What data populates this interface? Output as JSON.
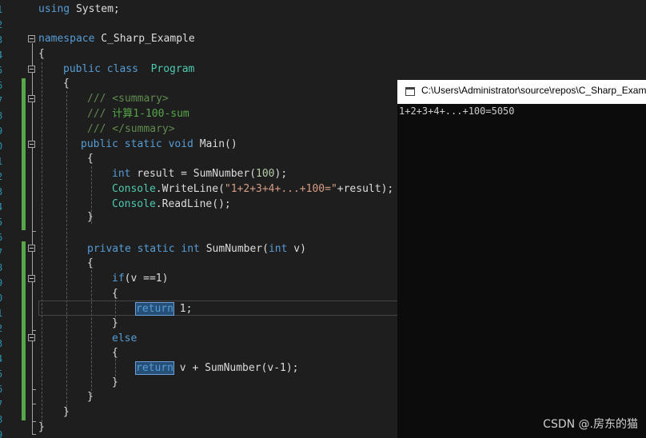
{
  "editor": {
    "line_numbers": [
      "1",
      "2",
      "3",
      "4",
      "5",
      "6",
      "7",
      "8",
      "9",
      "0",
      "1",
      "2",
      "3",
      "4",
      "5",
      "6",
      "7",
      "8",
      "9",
      "0",
      "1",
      "2",
      "3",
      "4",
      "5",
      "6",
      "7",
      "8",
      "9"
    ],
    "code": {
      "l1_using": "using",
      "l1_rest": " System;",
      "l3_kw": "namespace",
      "l3_name": " C_Sharp_Example",
      "l4": "{",
      "l5_kw": "public class",
      "l5_name": "Program",
      "l6": "{",
      "l7_slashes": "///",
      "l7_tag": " <summary>",
      "l8_slashes": "///",
      "l8_text": " 计算1-100-sum",
      "l9_slashes": "///",
      "l9_tag": " </summary>",
      "l10_kw": "public static void",
      "l10_name": " Main()",
      "l11": "{",
      "l12_kw": "int",
      "l12_mid": " result = SumNumber(",
      "l12_num": "100",
      "l12_end": ");",
      "l13_cls": "Console",
      "l13_mid": ".WriteLine(",
      "l13_str": "\"1+2+3+4+...+100=\"",
      "l13_end": "+result);",
      "l14_cls": "Console",
      "l14_end": ".ReadLine();",
      "l15": "}",
      "l17_kw": "private static int",
      "l17_mid": " SumNumber(",
      "l17_kw2": "int",
      "l17_end": " v)",
      "l18": "{",
      "l19_kw": "if",
      "l19_rest": "(v ==1)",
      "l20": "{",
      "l21_kw": "return",
      "l21_rest": " 1;",
      "l22": "}",
      "l23_kw": "else",
      "l24": "{",
      "l25_kw": "return",
      "l25_rest": " v + SumNumber(v-1);",
      "l26": "}",
      "l27": "}",
      "l28": "}",
      "l29": "}"
    }
  },
  "console": {
    "title": "C:\\Users\\Administrator\\source\\repos\\C_Sharp_Example",
    "output": "1+2+3+4+...+100=5050"
  },
  "watermark": "CSDN @.房东的猫",
  "colors": {
    "editor_bg": "#1e1e1e",
    "keyword": "#569cd6",
    "type": "#4ec9b0",
    "comment": "#57a64a",
    "string": "#d69d85",
    "console_bg": "#0c0c0c"
  }
}
